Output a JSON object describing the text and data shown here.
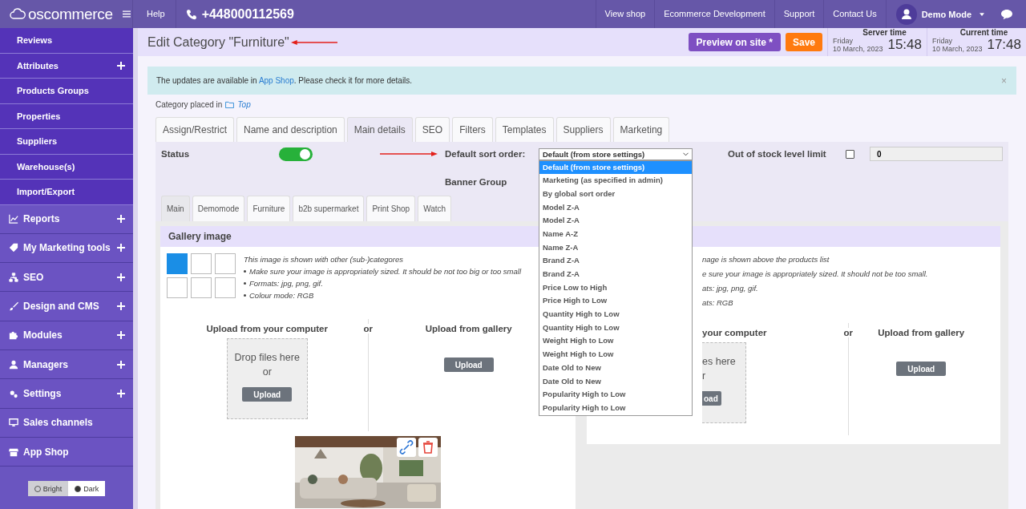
{
  "topbar": {
    "logo": "oscommerce",
    "help": "Help",
    "phone": "+448000112569",
    "links": [
      "View shop",
      "Ecommerce Development",
      "Support",
      "Contact Us"
    ],
    "user": "Demo Mode"
  },
  "sidebar": {
    "items": [
      {
        "label": "Reviews",
        "kind": "sub",
        "expandable": false
      },
      {
        "label": "Attributes",
        "kind": "sub",
        "expandable": true
      },
      {
        "label": "Products Groups",
        "kind": "sub",
        "expandable": false
      },
      {
        "label": "Properties",
        "kind": "sub",
        "expandable": false
      },
      {
        "label": "Suppliers",
        "kind": "sub",
        "expandable": false
      },
      {
        "label": "Warehouse(s)",
        "kind": "sub",
        "expandable": false
      },
      {
        "label": "Import/Export",
        "kind": "sub",
        "expandable": false
      },
      {
        "label": "Reports",
        "kind": "section",
        "expandable": true
      },
      {
        "label": "My Marketing tools",
        "kind": "section",
        "expandable": true
      },
      {
        "label": "SEO",
        "kind": "section",
        "expandable": true
      },
      {
        "label": "Design and CMS",
        "kind": "section",
        "expandable": true
      },
      {
        "label": "Modules",
        "kind": "section",
        "expandable": true
      },
      {
        "label": "Managers",
        "kind": "section",
        "expandable": true
      },
      {
        "label": "Settings",
        "kind": "section",
        "expandable": true
      },
      {
        "label": "Sales channels",
        "kind": "section",
        "expandable": false
      },
      {
        "label": "App Shop",
        "kind": "section",
        "expandable": false
      }
    ],
    "theme": [
      {
        "label": "Bright",
        "selected": true
      },
      {
        "label": "Dark",
        "selected": false
      }
    ]
  },
  "header": {
    "title": "Edit Category \"Furniture\"",
    "preview": "Preview on site *",
    "save": "Save",
    "times": [
      {
        "label": "Server time",
        "day": "Friday",
        "date": "10 March, 2023",
        "time": "15:48"
      },
      {
        "label": "Current time",
        "day": "Friday",
        "date": "10 March, 2023",
        "time": "17:48"
      }
    ]
  },
  "alert": {
    "before": "The updates are available in ",
    "link": "App Shop",
    "after": ". Please check it for more details.",
    "close": "×"
  },
  "placed": {
    "label": "Category placed in",
    "folder": "Top"
  },
  "tabs": [
    {
      "label": "Assign/Restrict",
      "selected": false
    },
    {
      "label": "Name and description",
      "selected": false
    },
    {
      "label": "Main details",
      "selected": true
    },
    {
      "label": "SEO",
      "selected": false
    },
    {
      "label": "Filters",
      "selected": false
    },
    {
      "label": "Templates",
      "selected": false
    },
    {
      "label": "Suppliers",
      "selected": false
    },
    {
      "label": "Marketing",
      "selected": false
    }
  ],
  "form": {
    "status_label": "Status",
    "status_on": true,
    "sort_label": "Default sort order:",
    "sort_value": "Default (from store settings)",
    "sort_options": [
      {
        "label": "Default (from store settings)",
        "selected": true
      },
      {
        "label": "Marketing (as specified in admin)",
        "selected": false
      },
      {
        "label": "By global sort order",
        "selected": false
      },
      {
        "label": "Model Z-A",
        "selected": false
      },
      {
        "label": "Model Z-A",
        "selected": false
      },
      {
        "label": "Name A-Z",
        "selected": false
      },
      {
        "label": "Name Z-A",
        "selected": false
      },
      {
        "label": "Brand Z-A",
        "selected": false
      },
      {
        "label": "Brand Z-A",
        "selected": false
      },
      {
        "label": "Price Low to High",
        "selected": false
      },
      {
        "label": "Price High to Low",
        "selected": false
      },
      {
        "label": "Quantity High to Low",
        "selected": false
      },
      {
        "label": "Quantity High to Low",
        "selected": false
      },
      {
        "label": "Weight High to Low",
        "selected": false
      },
      {
        "label": "Weight High to Low",
        "selected": false
      },
      {
        "label": "Date Old to New",
        "selected": false
      },
      {
        "label": "Date Old to New",
        "selected": false
      },
      {
        "label": "Popularity High to Low",
        "selected": false
      },
      {
        "label": "Popularity High to Low",
        "selected": false
      }
    ],
    "stock_label": "Out of stock level limit",
    "stock_checked": false,
    "stock_value": "0",
    "banner_label": "Banner Group"
  },
  "inner_tabs": [
    {
      "label": "Main",
      "selected": true
    },
    {
      "label": "Demomode",
      "selected": false
    },
    {
      "label": "Furniture",
      "selected": false
    },
    {
      "label": "b2b supermarket",
      "selected": false
    },
    {
      "label": "Print Shop",
      "selected": false
    },
    {
      "label": "Watch",
      "selected": false
    }
  ],
  "gallery": {
    "title": "Gallery image",
    "positions": [
      {
        "selected": true
      },
      {
        "selected": false
      },
      {
        "selected": false
      },
      {
        "selected": false
      },
      {
        "selected": false
      },
      {
        "selected": false
      }
    ],
    "caption": "This image is shown with other (sub-)categores",
    "bullets": [
      "Make sure your image is appropriately sized. It should be not too big or too small",
      "Formats: jpg, png, gif.",
      "Colour mode: RGB"
    ],
    "computer": "Upload from your computer",
    "drop": "Drop files here",
    "drop_or": "or",
    "upload": "Upload",
    "or": "or",
    "from_gallery": "Upload from gallery",
    "gallery_upload": "Upload",
    "image": {
      "kind": "picture"
    }
  },
  "category_image": {
    "caption": "nage is shown above the products list",
    "lines": [
      "e sure your image is appropriately sized. It should not be too small.",
      "ats: jpg, png, gif.",
      "ats: RGB"
    ],
    "computer": "your computer",
    "drop": "es here",
    "drop_or": "r",
    "upload": "oad",
    "or": "or",
    "from_gallery": "Upload from gallery",
    "gallery_upload": "Upload"
  }
}
